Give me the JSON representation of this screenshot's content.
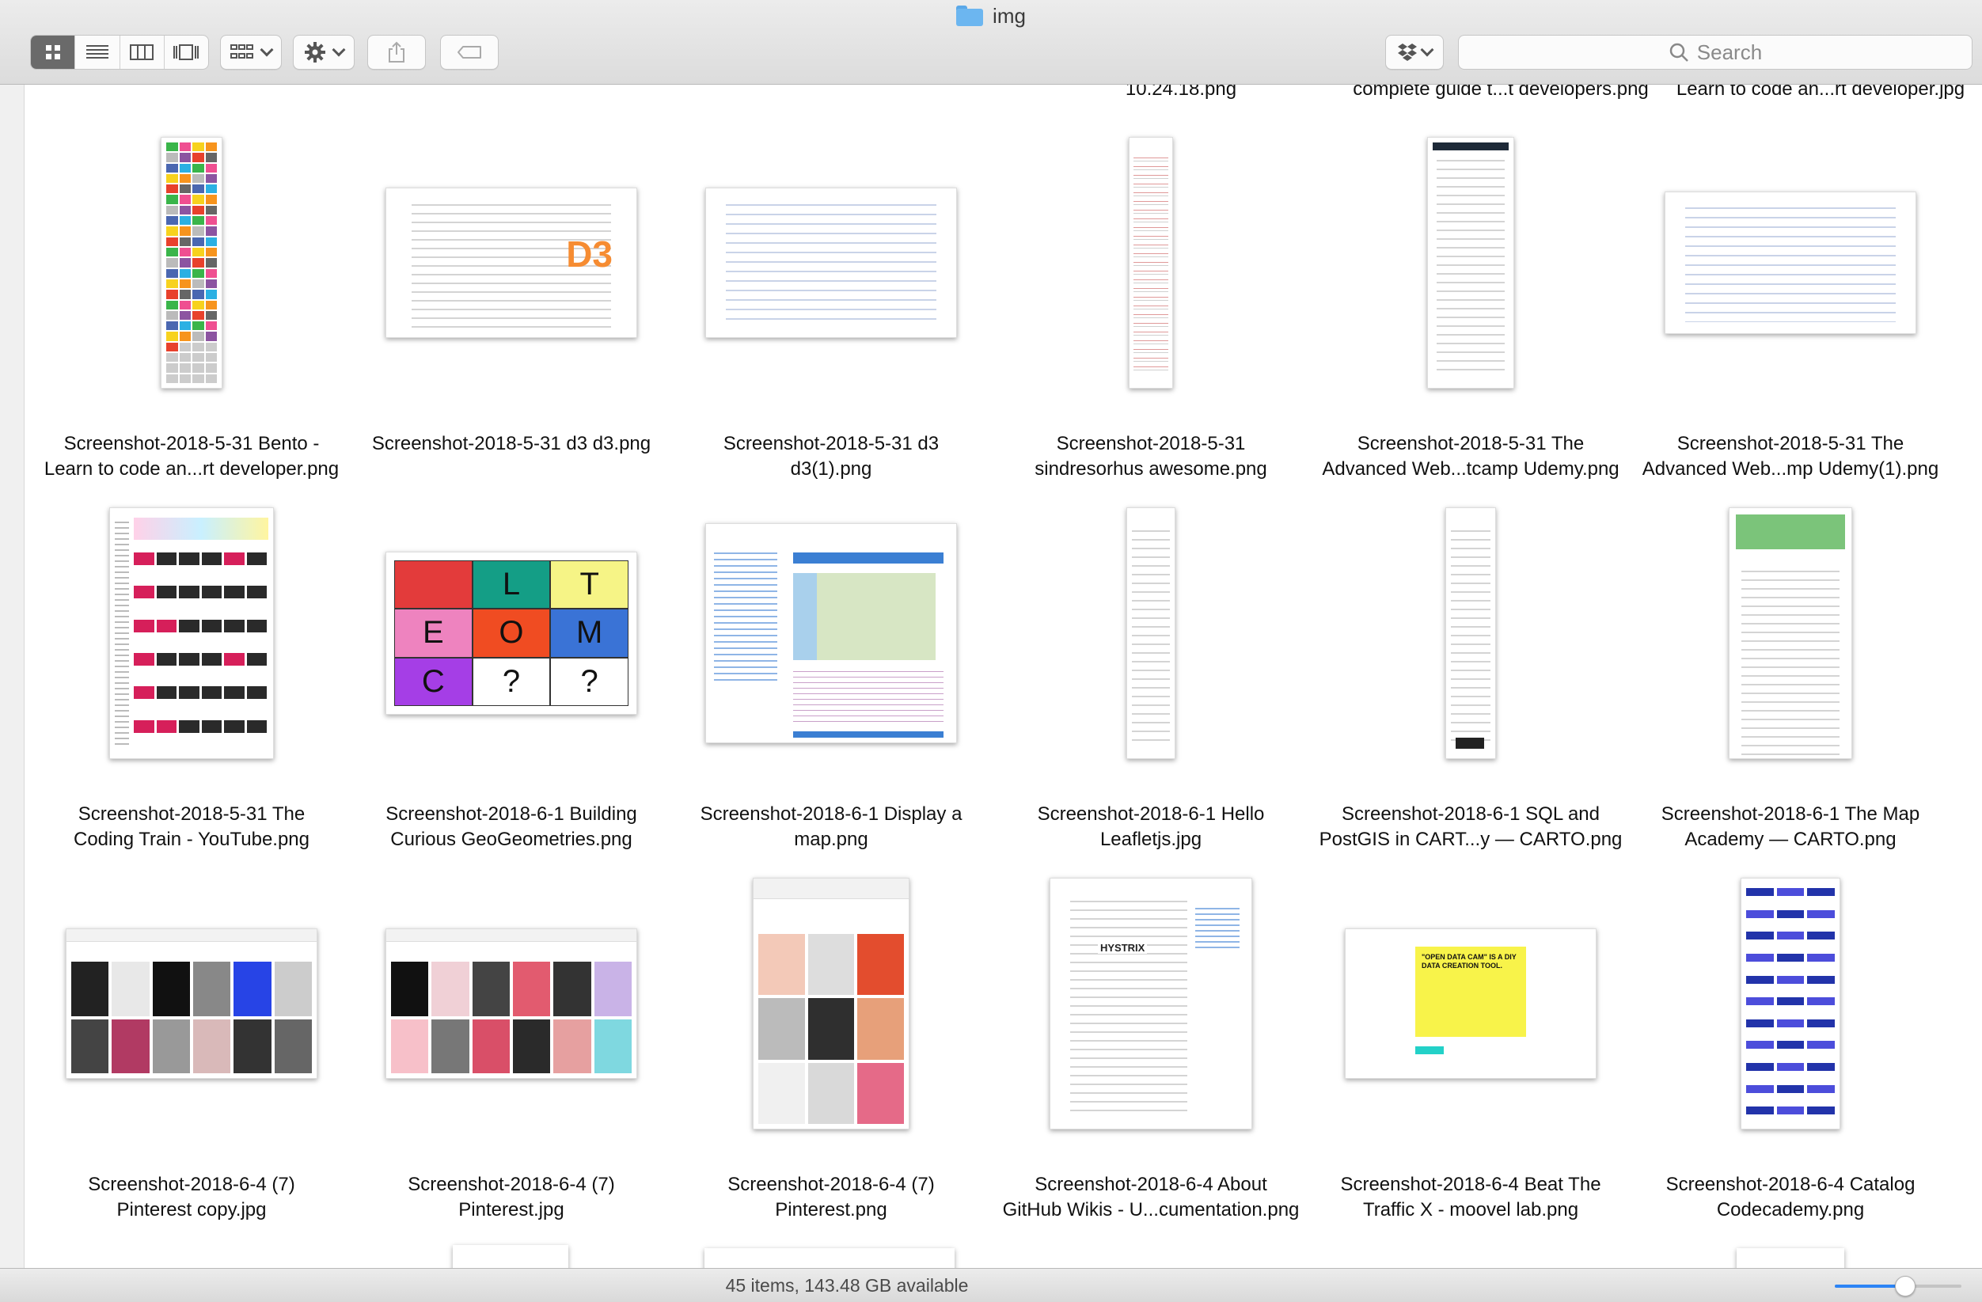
{
  "window": {
    "title": "img",
    "folder_icon": "folder-icon"
  },
  "toolbar": {
    "view_modes": [
      {
        "name": "icon-view",
        "icon": "icon-grid-icon",
        "selected": true
      },
      {
        "name": "list-view",
        "icon": "list-icon",
        "selected": false
      },
      {
        "name": "column-view",
        "icon": "columns-icon",
        "selected": false
      },
      {
        "name": "gallery-view",
        "icon": "gallery-icon",
        "selected": false
      }
    ],
    "group_icon": "group-by-icon",
    "action_icon": "gear-icon",
    "share_icon": "share-icon",
    "tag_icon": "tag-icon",
    "dropbox_icon": "dropbox-icon",
    "search_placeholder": "Search"
  },
  "previous_row_labels": [
    "",
    "",
    "",
    "10.24.18.png",
    "complete guide t...t developers.png",
    "Learn to code an...rt developer.jpg"
  ],
  "files": [
    {
      "name": "Screenshot-2018-5-31 Bento -\nLearn to code an...rt developer.png",
      "thumb": "bento"
    },
    {
      "name": "Screenshot-2018-5-31 d3 d3.png",
      "thumb": "d3gallery"
    },
    {
      "name": "Screenshot-2018-5-31 d3\nd3(1).png",
      "thumb": "d3examples"
    },
    {
      "name": "Screenshot-2018-5-31\nsindresorhus awesome.png",
      "thumb": "awesome"
    },
    {
      "name": "Screenshot-2018-5-31 The\nAdvanced Web...tcamp Udemy.png",
      "thumb": "udemy-tall"
    },
    {
      "name": "Screenshot-2018-5-31 The\nAdvanced Web...mp Udemy(1).png",
      "thumb": "udemy-wide"
    },
    {
      "name": "Screenshot-2018-5-31 The\nCoding Train - YouTube.png",
      "thumb": "youtube"
    },
    {
      "name": "Screenshot-2018-6-1 Building\nCurious GeoGeometries.png",
      "thumb": "geogeometries"
    },
    {
      "name": "Screenshot-2018-6-1 Display a\nmap.png",
      "thumb": "map"
    },
    {
      "name": "Screenshot-2018-6-1 Hello\nLeafletjs.jpg",
      "thumb": "leaflet"
    },
    {
      "name": "Screenshot-2018-6-1 SQL and\nPostGIS in CART...y — CARTO.png",
      "thumb": "carto-sql"
    },
    {
      "name": "Screenshot-2018-6-1 The Map\nAcademy — CARTO.png",
      "thumb": "map-academy"
    },
    {
      "name": "Screenshot-2018-6-4 (7)\nPinterest copy.jpg",
      "thumb": "pinterest1"
    },
    {
      "name": "Screenshot-2018-6-4 (7)\nPinterest.jpg",
      "thumb": "pinterest2"
    },
    {
      "name": "Screenshot-2018-6-4 (7)\nPinterest.png",
      "thumb": "pinterest3"
    },
    {
      "name": "Screenshot-2018-6-4 About\nGitHub Wikis - U...cumentation.png",
      "thumb": "github-wikis"
    },
    {
      "name": "Screenshot-2018-6-4 Beat The\nTraffic X - moovel lab.png",
      "thumb": "moovel"
    },
    {
      "name": "Screenshot-2018-6-4 Catalog\nCodecademy.png",
      "thumb": "codecademy"
    }
  ],
  "geo_tiles": {
    "row1": [
      "",
      "L",
      "T"
    ],
    "row2": [
      "E",
      "O",
      "M"
    ],
    "row3": [
      "C",
      "?",
      "?"
    ]
  },
  "thumb_text": {
    "d3_logo": "D3",
    "moovel_headline": "\"OPEN DATA CAM\" IS A DIY DATA CREATION TOOL.",
    "github_brand": "HYSTRIX"
  },
  "status": {
    "text": "45 items, 143.48 GB available",
    "icon_size_level": 0.55
  },
  "colors": {
    "accent": "#2c84f5",
    "geo_tiles": [
      "#e33b3b",
      "#149e86",
      "#f6f486",
      "#ee83bf",
      "#f04c22",
      "#3a73d6",
      "#a53ee6",
      "#ffffff",
      "#ffffff"
    ]
  }
}
